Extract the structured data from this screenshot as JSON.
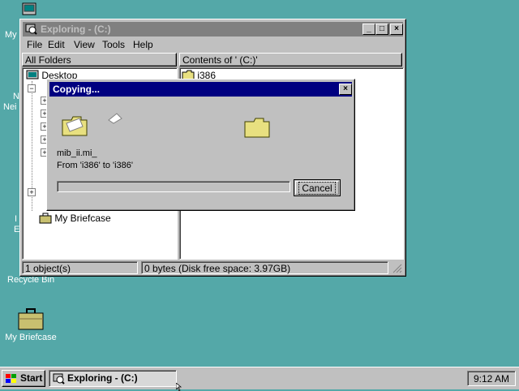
{
  "desktop": {
    "icons": [
      {
        "label": "My"
      },
      {
        "label": "N"
      },
      {
        "label": "Nei"
      },
      {
        "label": "I"
      },
      {
        "label": "E"
      },
      {
        "label": "Recycle Bin"
      },
      {
        "label": "My Briefcase"
      }
    ]
  },
  "explorer": {
    "title": "Exploring -  (C:)",
    "menu": [
      "File",
      "Edit",
      "View",
      "Tools",
      "Help"
    ],
    "left_header": "All Folders",
    "right_header": "Contents of ' (C:)'",
    "tree": [
      {
        "label": "Desktop"
      },
      {
        "label": "My Briefcase"
      }
    ],
    "files": [
      {
        "label": "i386"
      }
    ],
    "status": {
      "objects": "1 object(s)",
      "space": "0 bytes (Disk free space: 3.97GB)"
    }
  },
  "copy_dialog": {
    "title": "Copying...",
    "filename": "mib_ii.mi_",
    "from_to": "From 'i386' to 'i386'",
    "cancel_label": "Cancel",
    "progress": 0
  },
  "taskbar": {
    "start_label": "Start",
    "task_label": "Exploring -  (C:)",
    "clock": "9:12 AM"
  },
  "colors": {
    "desktop": "#54a8a8",
    "active_title": "#000080",
    "inactive_title": "#808080",
    "face": "#c0c0c0"
  }
}
